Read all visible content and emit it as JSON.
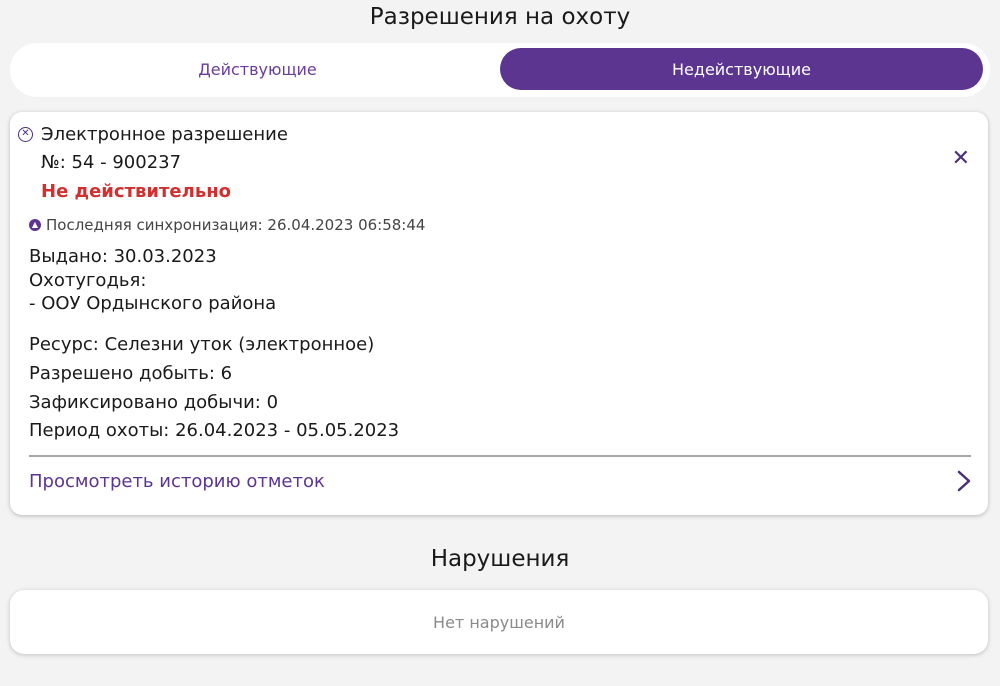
{
  "header": {
    "title": "Разрешения на охоту"
  },
  "tabs": [
    {
      "label": "Действующие",
      "active": false
    },
    {
      "label": "Недействующие",
      "active": true
    }
  ],
  "permit": {
    "type": "Электронное разрешение",
    "number": "№: 54 - 900237",
    "status": "Не действительно",
    "sync": "Последняя синхронизация: 26.04.2023 06:58:44",
    "issued": "Выдано: 30.03.2023",
    "grounds_label": "Охотугодья:",
    "grounds_value": "- ООУ Ордынского района",
    "resource": "Ресурс: Селезни уток (электронное)",
    "allowed": "Разрешено добыть: 6",
    "recorded": "Зафиксировано добычи: 0",
    "period": "Период охоты: 26.04.2023 - 05.05.2023",
    "history_link": "Просмотреть историю отметок"
  },
  "violations": {
    "title": "Нарушения",
    "empty_text": "Нет нарушений"
  },
  "colors": {
    "accent": "#5b3590",
    "invalid": "#d32f2f"
  },
  "icons": {
    "status": "cancel-circle-icon",
    "sync": "upload-circle-icon",
    "close": "close-icon",
    "chevron": "chevron-right-icon"
  }
}
